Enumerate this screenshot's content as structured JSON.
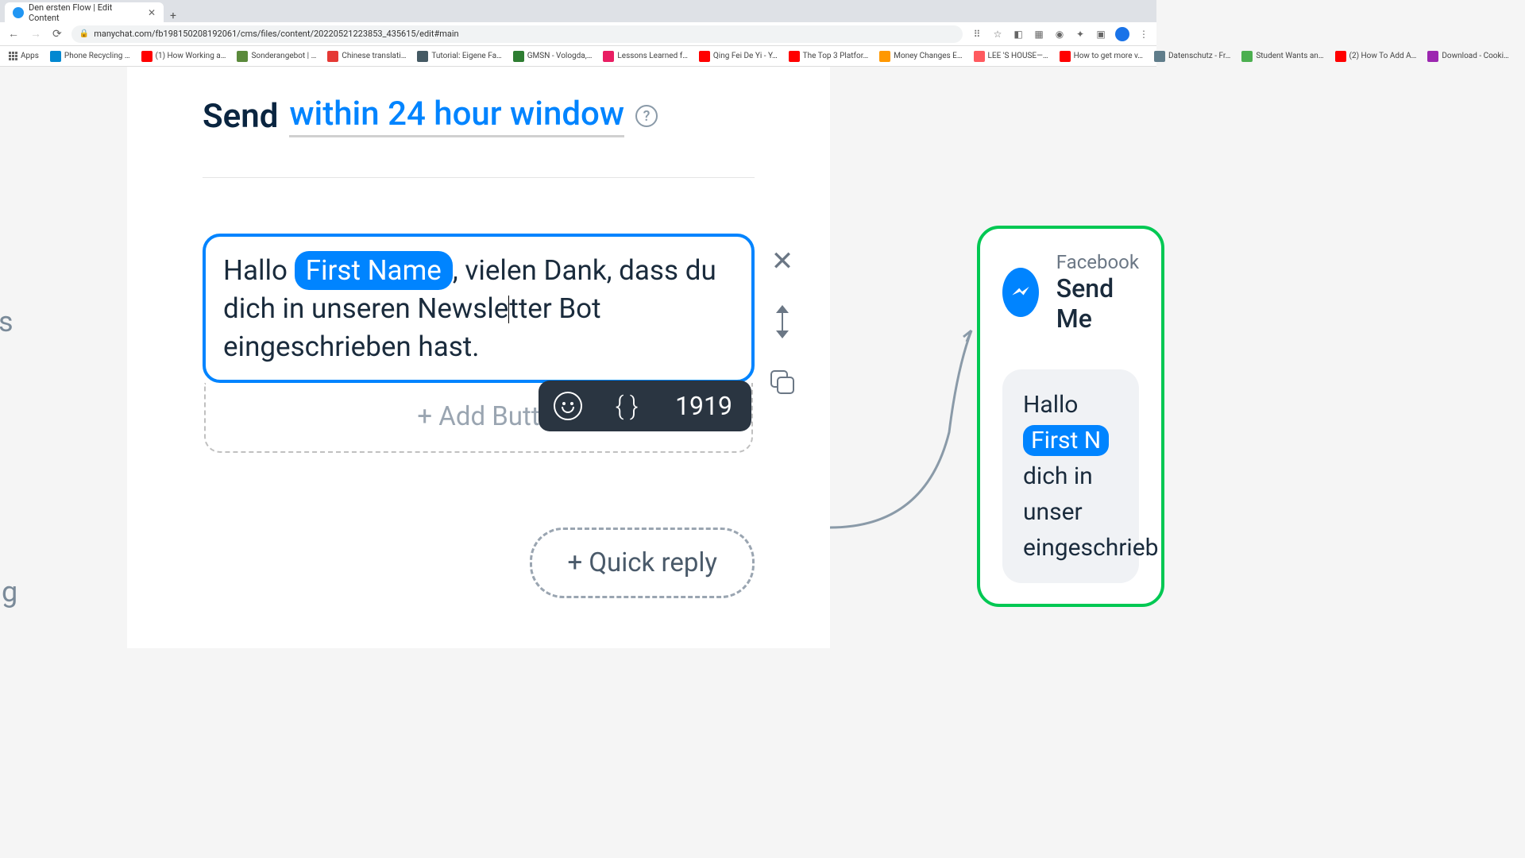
{
  "browser": {
    "tab_title": "Den ersten Flow | Edit Content",
    "url": "manychat.com/fb198150208192061/cms/files/content/20220521223853_435615/edit#main"
  },
  "bookmarks": [
    {
      "label": "Apps",
      "color": "#666"
    },
    {
      "label": "Phone Recycling …",
      "color": "#0288d1"
    },
    {
      "label": "(1) How Working a…",
      "color": "#ff0000"
    },
    {
      "label": "Sonderangebot | …",
      "color": "#5b8a3c"
    },
    {
      "label": "Chinese translati…",
      "color": "#e53935"
    },
    {
      "label": "Tutorial: Eigene Fa…",
      "color": "#455a64"
    },
    {
      "label": "GMSN - Vologda,…",
      "color": "#2e7d32"
    },
    {
      "label": "Lessons Learned f…",
      "color": "#e91e63"
    },
    {
      "label": "Qing Fei De Yi - Y…",
      "color": "#ff0000"
    },
    {
      "label": "The Top 3 Platfor…",
      "color": "#ff0000"
    },
    {
      "label": "Money Changes E…",
      "color": "#ff9800"
    },
    {
      "label": "LEE 'S HOUSE—…",
      "color": "#ff5a5f"
    },
    {
      "label": "How to get more v…",
      "color": "#ff0000"
    },
    {
      "label": "Datenschutz - Fr…",
      "color": "#607d8b"
    },
    {
      "label": "Student Wants an…",
      "color": "#4caf50"
    },
    {
      "label": "(2) How To Add A…",
      "color": "#ff0000"
    },
    {
      "label": "Download - Cooki…",
      "color": "#9c27b0"
    }
  ],
  "header": {
    "send_label": "Send",
    "window_label": "within 24 hour window"
  },
  "editor": {
    "text_before": "Hallo ",
    "variable": "First Name",
    "text_mid1": ", vielen Dank, dass du dich in unseren Newsle",
    "text_mid2": "tter Bot eingeschrieben hast.",
    "add_button_label": "+ Add Butt",
    "char_count": "1919",
    "variable_braces": "{ }"
  },
  "side_actions": {
    "close": "✕"
  },
  "quick_reply": {
    "label": "+ Quick reply"
  },
  "preview": {
    "platform": "Facebook",
    "action": "Send Me",
    "msg_prefix": "Hallo ",
    "msg_variable": "First N",
    "msg_line2": "dich in unser",
    "msg_line3": "eingeschrieb"
  },
  "left_edge": {
    "s": "s",
    "g": "g"
  }
}
